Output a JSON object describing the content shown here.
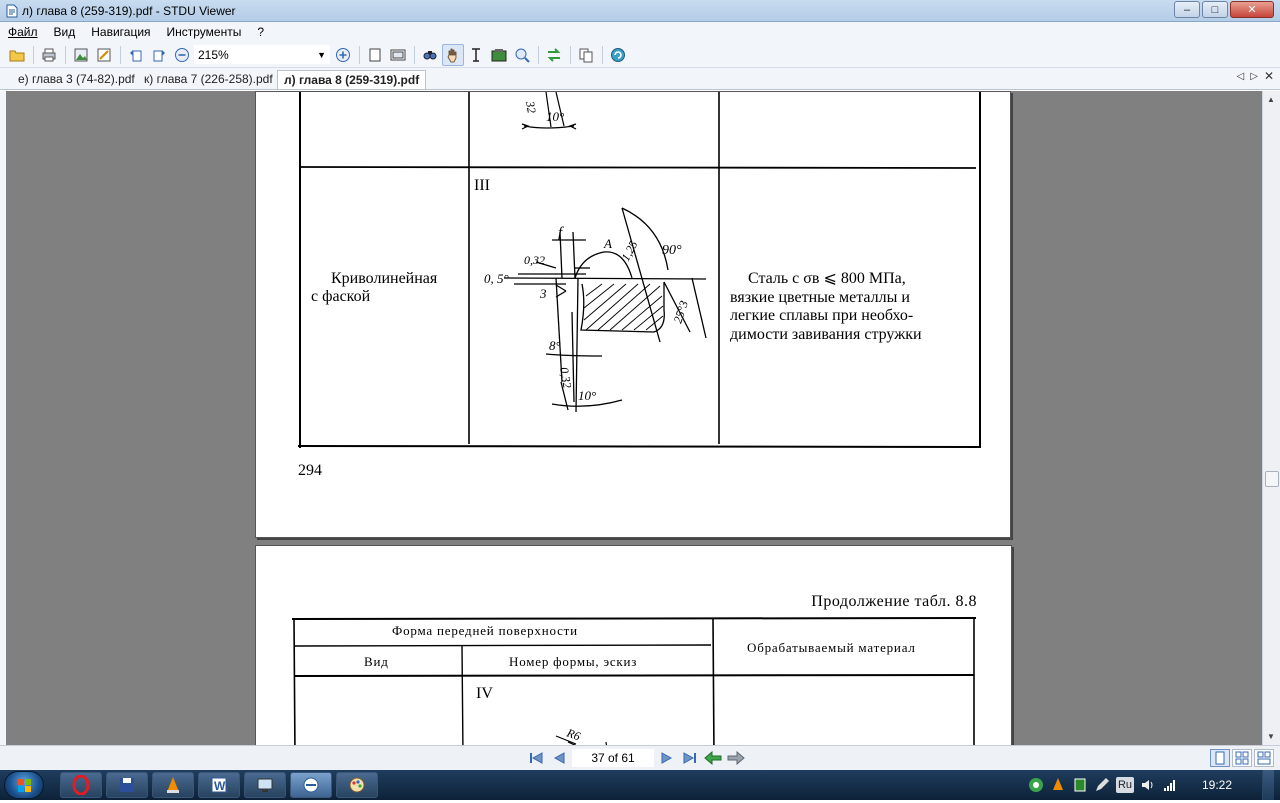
{
  "window": {
    "title": "л) глава 8 (259-319).pdf - STDU Viewer",
    "minimize": "‒",
    "maximize": "□",
    "close": "✕"
  },
  "menu": [
    "Файл",
    "Вид",
    "Навигация",
    "Инструменты",
    "?"
  ],
  "toolbar": {
    "zoom": "215%",
    "icons": [
      "open-icon",
      "print-icon",
      "export-image-icon",
      "export-text-icon",
      "rotate-left-icon",
      "rotate-right-icon",
      "zoom-out-icon",
      "zoom-in-icon",
      "single-page-icon",
      "facing-pages-icon",
      "find-icon",
      "hand-tool-icon",
      "text-select-icon",
      "snapshot-icon",
      "magnifier-icon",
      "sync-icon",
      "copy-icon",
      "update-icon"
    ]
  },
  "tabs": [
    {
      "label": "е) глава 3 (74-82).pdf",
      "active": false
    },
    {
      "label": "к) глава 7 (226-258).pdf",
      "active": false
    },
    {
      "label": "л) глава 8 (259-319).pdf",
      "active": true
    }
  ],
  "document": {
    "page1": {
      "form_label": "III",
      "row_left_line1": "Криволинейная",
      "row_left_line2": "с фаской",
      "row_right_line1": "Сталь  с  σв ⩽ 800  МПа,",
      "row_right_line2": "вязкие цветные металлы и",
      "row_right_line3": "легкие сплавы при необхо-",
      "row_right_line4": "димости завивания стружки",
      "page_number": "294",
      "dims": {
        "f": "f",
        "a": "A",
        "r1": "1,25",
        "a90": "90°",
        "d032a": "0,32",
        "half_deg": "0, 5°",
        "three": "3",
        "slope": "25°3",
        "eight": "8°",
        "d032b": "0,32",
        "ten_top": "10°",
        "ten_bottom": "10°",
        "top_32": "32"
      }
    },
    "page2": {
      "continuation": "Продолжение табл. 8.8",
      "header_shape": "Форма передней поверхности",
      "header_view": "Вид",
      "header_form": "Номер формы, эскиз",
      "header_material": "Обрабатываемый материал",
      "form_label": "IV",
      "r6": "R6"
    }
  },
  "statusbar": {
    "page_indicator": "37 of 61"
  },
  "taskbar": {
    "language": "Ru",
    "time": "19:22"
  }
}
